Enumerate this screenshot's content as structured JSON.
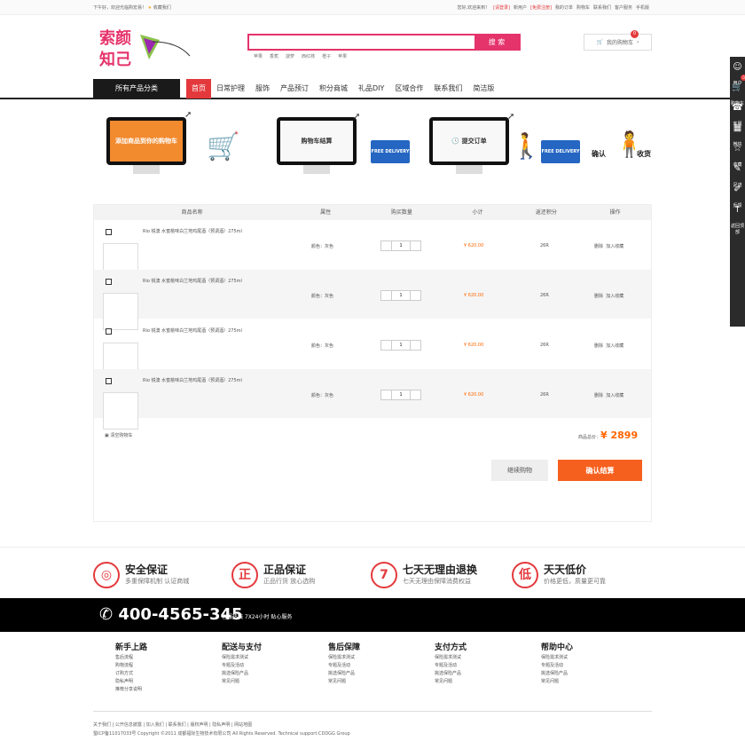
{
  "topbar": {
    "greeting": "下午好，欢迎光临购宏易！",
    "fav": "收藏我们",
    "hello_pre": "您好,欢迎来到！",
    "login": "[请登录]",
    "newuser": "新用户",
    "register": "[免费注册]",
    "my_orders": "我的订单",
    "cart": "购物车",
    "contact": "联系我们",
    "service": "客户服务",
    "mobile": "手机版"
  },
  "logo": {
    "line1": "索颜",
    "line2": "知己"
  },
  "search": {
    "placeholder": "",
    "button": "搜 索",
    "hot": [
      "苹果",
      "香蕉",
      "菠萝",
      "西红柿",
      "橙子",
      "苹果"
    ]
  },
  "cart_button": {
    "label": "我的购物车",
    "count": "0"
  },
  "nav": {
    "all_categories": "所有产品分类",
    "items": [
      "首页",
      "日常护理",
      "服饰",
      "产品预订",
      "积分商城",
      "礼品DIY",
      "区域合作",
      "联系我们",
      "简洁版"
    ]
  },
  "steps": {
    "s1": "添加商品到你的购物车",
    "s2": "购物车结算",
    "s3": "提交订单",
    "truck": "FREE DELIVERY",
    "confirm1": "确认",
    "confirm2": "收货"
  },
  "table": {
    "headers": [
      "商品名称",
      "属性",
      "购买数量",
      "小计",
      "返还积分",
      "操作"
    ],
    "rows": [
      {
        "name": "Rio 锐澳 水蜜桃味白兰地鸡尾酒（预调酒）275ml",
        "attr": "颜色：灰色",
        "qty": "1",
        "subtotal": "¥ 620.00",
        "points": "26R",
        "delete": "删除",
        "fav": "加入收藏"
      },
      {
        "name": "Rio 锐澳 水蜜桃味白兰地鸡尾酒（预调酒）275ml",
        "attr": "颜色：灰色",
        "qty": "1",
        "subtotal": "¥ 620.00",
        "points": "26R",
        "delete": "删除",
        "fav": "加入收藏"
      },
      {
        "name": "Rio 锐澳 水蜜桃味白兰地鸡尾酒（预调酒）275ml",
        "attr": "颜色：灰色",
        "qty": "1",
        "subtotal": "¥ 620.00",
        "points": "26R",
        "delete": "删除",
        "fav": "加入收藏"
      },
      {
        "name": "Rio 锐澳 水蜜桃味白兰地鸡尾酒（预调酒）275ml",
        "attr": "颜色：灰色",
        "qty": "1",
        "subtotal": "¥ 620.00",
        "points": "26R",
        "delete": "删除",
        "fav": "加入收藏"
      }
    ],
    "clear": "清空购物车",
    "total_label": "商品总价：",
    "total_value": "¥ 2899",
    "continue": "继续购物",
    "confirm": "确认结算"
  },
  "guarantees": [
    {
      "icon": "◎",
      "title": "安全保证",
      "sub": "多重保障机制 认证商城"
    },
    {
      "icon": "正",
      "title": "正品保证",
      "sub": "正品行货 放心选购"
    },
    {
      "icon": "7",
      "title": "七天无理由退换",
      "sub": "七天无理由保障消费权益"
    },
    {
      "icon": "低",
      "title": "天天低价",
      "sub": "价格更低，质量更可靠"
    }
  ],
  "hotline": {
    "phone": "400-4565-345",
    "tip": "客服热线 7X24小时 贴心服务"
  },
  "footer_links": [
    {
      "title": "新手上路",
      "items": [
        "售后流程",
        "购物流程",
        "订购方式",
        "隐私声明",
        "推荐分享说明"
      ]
    },
    {
      "title": "配送与支付",
      "items": [
        "保险需求测试",
        "专题及活动",
        "挑选保险产品",
        "常见问题"
      ]
    },
    {
      "title": "售后保障",
      "items": [
        "保险需求测试",
        "专题及活动",
        "挑选保险产品",
        "常见问题"
      ]
    },
    {
      "title": "支付方式",
      "items": [
        "保险需求测试",
        "专题及活动",
        "挑选保险产品",
        "常见问题"
      ]
    },
    {
      "title": "帮助中心",
      "items": [
        "保险需求测试",
        "专题及活动",
        "挑选保险产品",
        "常见问题"
      ]
    }
  ],
  "bottom": {
    "links": "关于我们 | 公开信息披露 | 加入我们 | 联系我们 | 版权声明 | 隐私声明 | 网站地图",
    "copyright": "蜀ICP备11017033号 Copyright ©2011 成都福际生物技术有限公司 All Rights Reserved. Technical support:CDDGG Group"
  },
  "sidebar": [
    {
      "icon": "☺",
      "label": "用户"
    },
    {
      "icon": "🛒",
      "label": "购物车"
    },
    {
      "icon": "☎",
      "label": "客服"
    },
    {
      "icon": "▦",
      "label": "微信"
    },
    {
      "icon": "☆",
      "label": "收藏"
    },
    {
      "icon": "✎",
      "label": "足迹"
    },
    {
      "icon": "✐",
      "label": "反馈"
    },
    {
      "icon": "↑",
      "label": "返回顶部"
    }
  ],
  "sidebar_badge": "0"
}
